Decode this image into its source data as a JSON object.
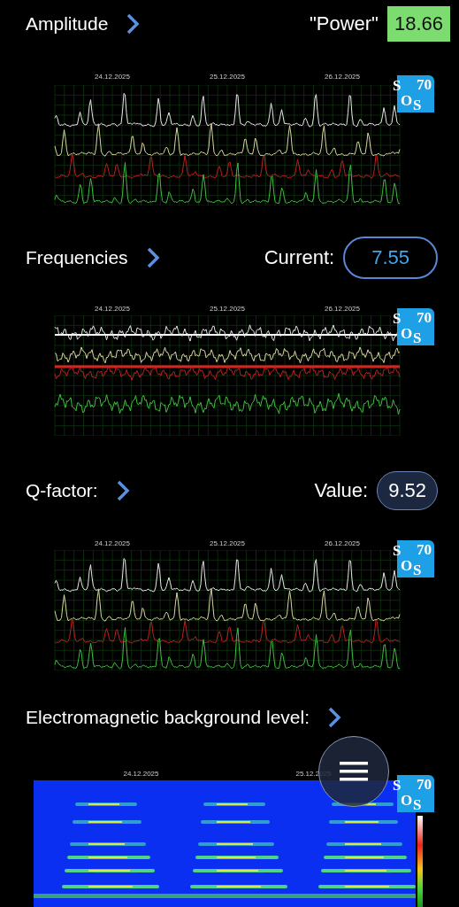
{
  "sections": [
    {
      "title": "Amplitude",
      "value_label": "\"Power\"",
      "value": "18.66",
      "kind": "flat",
      "chart": {
        "kind": "lines",
        "dates": [
          "24.12.2025",
          "25.12.2025",
          "26.12.2025"
        ],
        "logo": [
          "S",
          "70",
          "O",
          "S"
        ]
      }
    },
    {
      "title": "Frequencies",
      "value_label": "Current:",
      "value": "7.55",
      "kind": "outlined",
      "chart": {
        "kind": "wave",
        "dates": [
          "24.12.2025",
          "25.12.2025",
          "26.12.2025"
        ],
        "logo": [
          "S",
          "70",
          "O",
          "S"
        ]
      }
    },
    {
      "title": "Q-factor:",
      "value_label": "Value:",
      "value": "9.52",
      "kind": "filled",
      "chart": {
        "kind": "lines",
        "dates": [
          "24.12.2025",
          "25.12.2025",
          "26.12.2025"
        ],
        "logo": [
          "S",
          "70",
          "O",
          "S"
        ]
      }
    },
    {
      "title": "Electromagnetic background level:",
      "kind": "none",
      "chart": {
        "kind": "spectrogram",
        "dates": [
          "24.12.2025",
          "25.12.2025"
        ],
        "logo": [
          "S",
          "70",
          "O",
          "S"
        ]
      }
    }
  ]
}
